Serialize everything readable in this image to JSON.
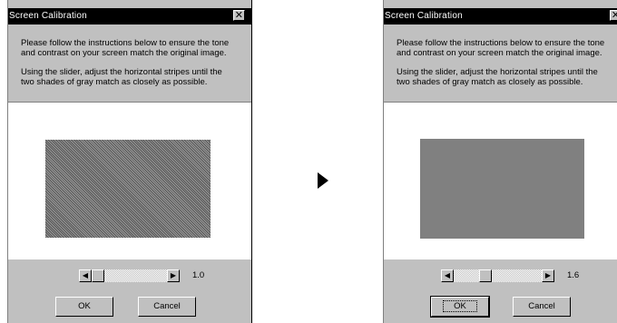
{
  "left_dialog": {
    "title": "Screen Calibration",
    "close_glyph": "✕",
    "instruction_1_line1": "Please follow the instructions below to ensure the tone",
    "instruction_1_line2": "and contrast on your screen match the original image.",
    "instruction_2_line1": "Using the slider, adjust the horizontal stripes until the",
    "instruction_2_line2": "two shades of gray match as closely as possible.",
    "slider_value": "1.0",
    "ok_label": "OK",
    "cancel_label": "Cancel"
  },
  "right_dialog": {
    "title": "Screen Calibration",
    "close_glyph": "✕",
    "instruction_1_line1": "Please follow the instructions below to ensure the tone",
    "instruction_1_line2": "and contrast on your screen match the original image.",
    "instruction_2_line1": "Using the slider, adjust the horizontal stripes until the",
    "instruction_2_line2": "two shades of gray match as closely as possible.",
    "slider_value": "1.6",
    "ok_label": "OK",
    "cancel_label": "Cancel"
  },
  "icons": {
    "transition": "arrow-right-icon",
    "scroll_left": "scroll-left-arrow-icon",
    "scroll_right": "scroll-right-arrow-icon"
  },
  "colors": {
    "titlebar": "#000000",
    "dialog_face": "#c0c0c0",
    "preview_bg": "#ffffff",
    "matched_gray": "#808080"
  }
}
